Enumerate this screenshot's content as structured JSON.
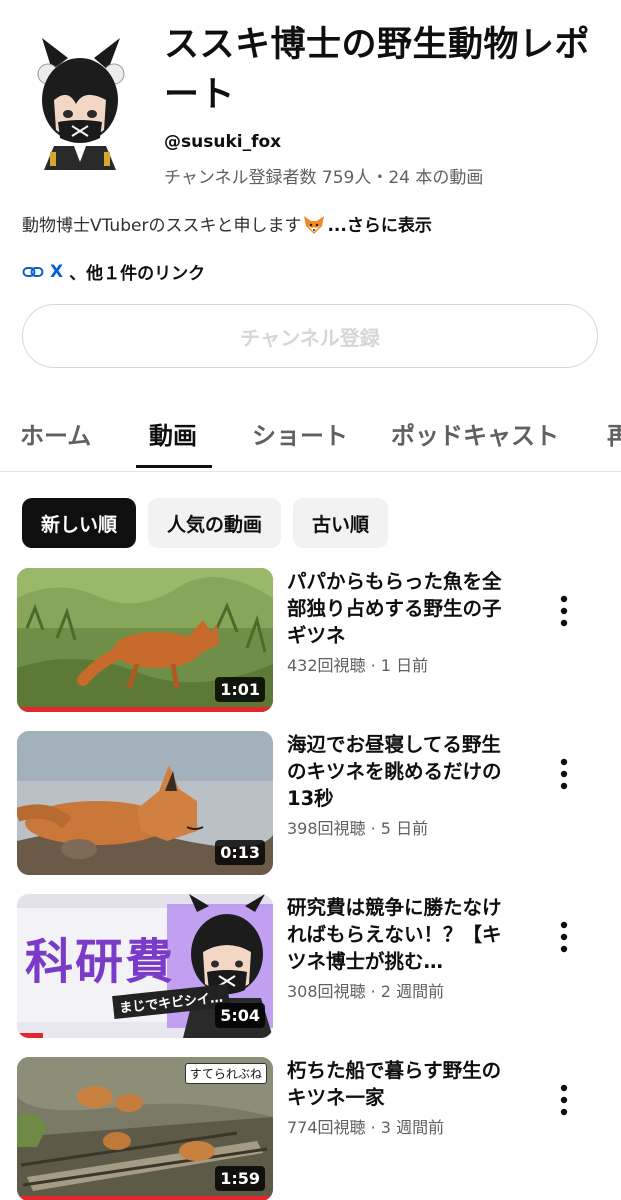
{
  "channel": {
    "title": "ススキ博士の野生動物レポート",
    "handle": "@susuki_fox",
    "stats": "チャンネル登録者数 759人・24 本の動画",
    "description": "動物博士VTuberのススキと申します",
    "description_more": "...さらに表示",
    "link_x": "X",
    "link_more": "、他１件のリンク",
    "subscribe_label": "チャンネル登録"
  },
  "tabs": [
    {
      "label": "ホーム"
    },
    {
      "label": "動画"
    },
    {
      "label": "ショート"
    },
    {
      "label": "ポッドキャスト"
    },
    {
      "label": "再"
    }
  ],
  "chips": [
    {
      "label": "新しい順"
    },
    {
      "label": "人気の動画"
    },
    {
      "label": "古い順"
    }
  ],
  "videos": [
    {
      "title": "パパからもらった魚を全部独り占めする野生の子ギツネ",
      "meta": "432回視聴 · 1 日前",
      "duration": "1:01",
      "watched_fraction": 1.0
    },
    {
      "title": "海辺でお昼寝してる野生のキツネを眺めるだけの13秒",
      "meta": "398回視聴 · 5 日前",
      "duration": "0:13",
      "watched_fraction": 0
    },
    {
      "title": "研究費は競争に勝たなければもらえない！？【キツネ博士が挑む…",
      "meta": "308回視聴 · 2 週間前",
      "duration": "5:04",
      "watched_fraction": 0.1,
      "thumb_text": "科研費",
      "thumb_subtext": "まじでキビシイ…"
    },
    {
      "title": "朽ちた船で暮らす野生のキツネ一家",
      "meta": "774回視聴 · 3 週間前",
      "duration": "1:59",
      "watched_fraction": 1.0,
      "thumb_badge": "すてられぶね"
    }
  ],
  "colors": {
    "accent_red": "#e4262f",
    "link_blue": "#065fd4"
  },
  "icons": [
    "link-icon",
    "more-vert-icon",
    "fox-emoji-icon"
  ]
}
